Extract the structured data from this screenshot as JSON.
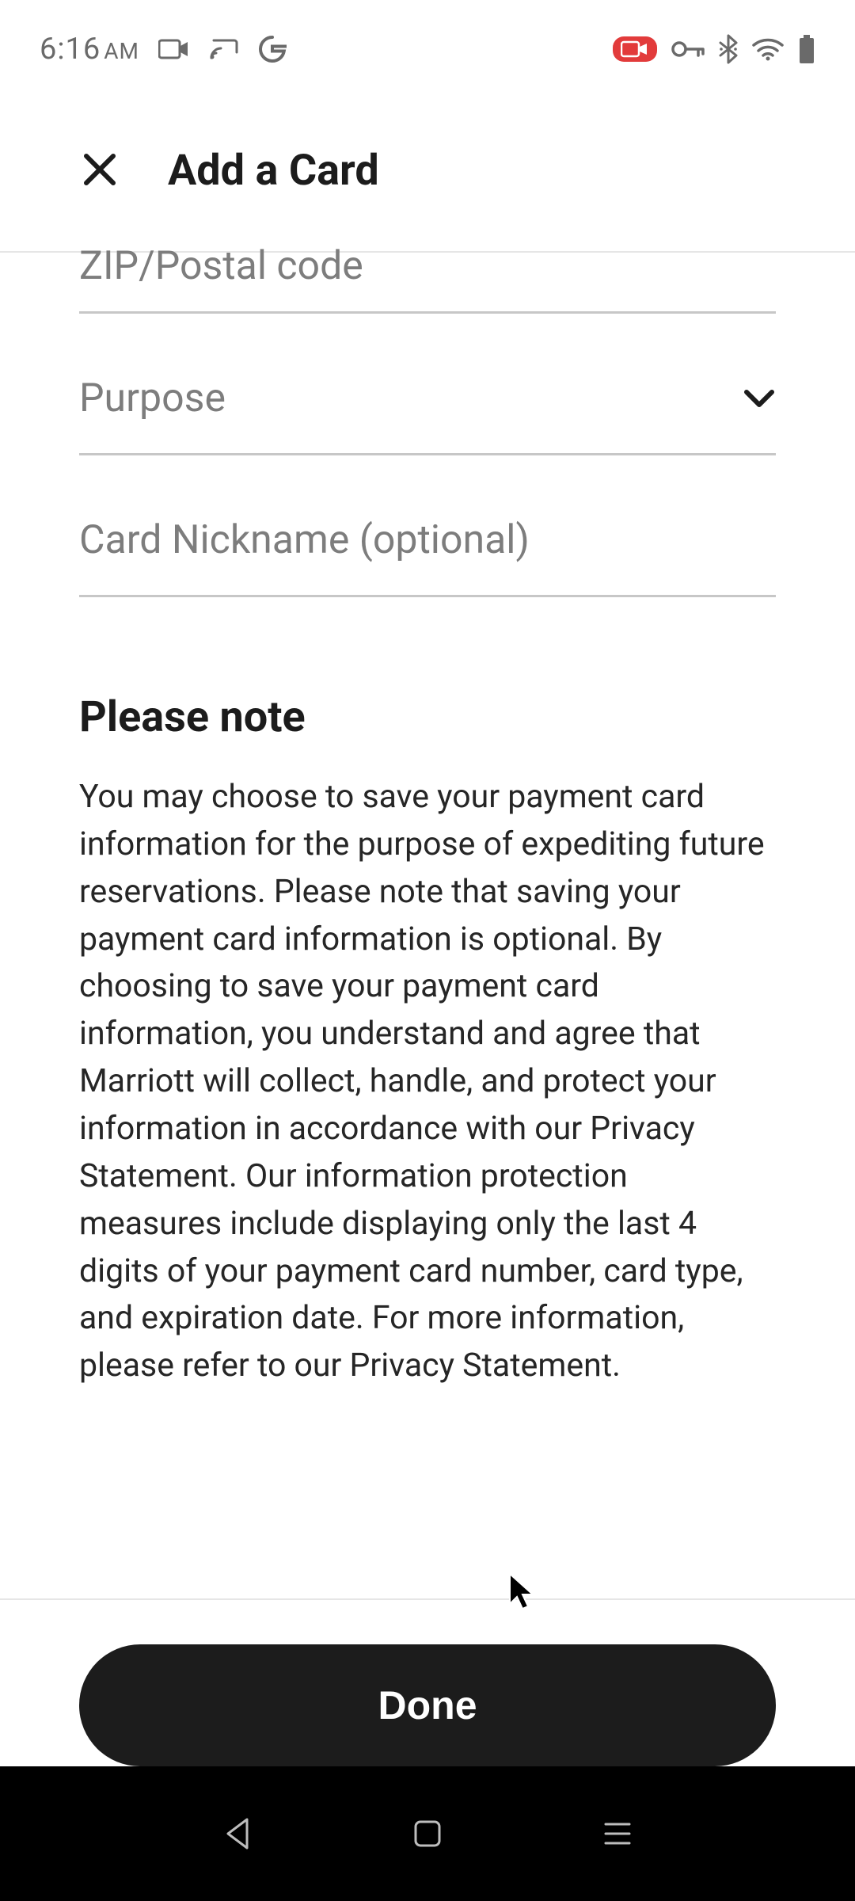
{
  "status": {
    "time": "6:16",
    "ampm": "AM"
  },
  "header": {
    "title": "Add a Card"
  },
  "fields": {
    "zip_placeholder": "ZIP/Postal code",
    "purpose_placeholder": "Purpose",
    "nickname_placeholder": "Card Nickname (optional)"
  },
  "note": {
    "title": "Please note",
    "body": "You may choose to save your payment card information for the purpose of expediting future reservations. Please note that saving your payment card information is optional. By choosing to save your payment card information, you understand and agree that Marriott will collect, handle, and protect your information in accordance with our Privacy Statement. Our information protection measures include displaying only the last 4 digits of your payment card number, card type, and expiration date. For more information, please refer to our Privacy Statement."
  },
  "footer": {
    "done_label": "Done"
  }
}
